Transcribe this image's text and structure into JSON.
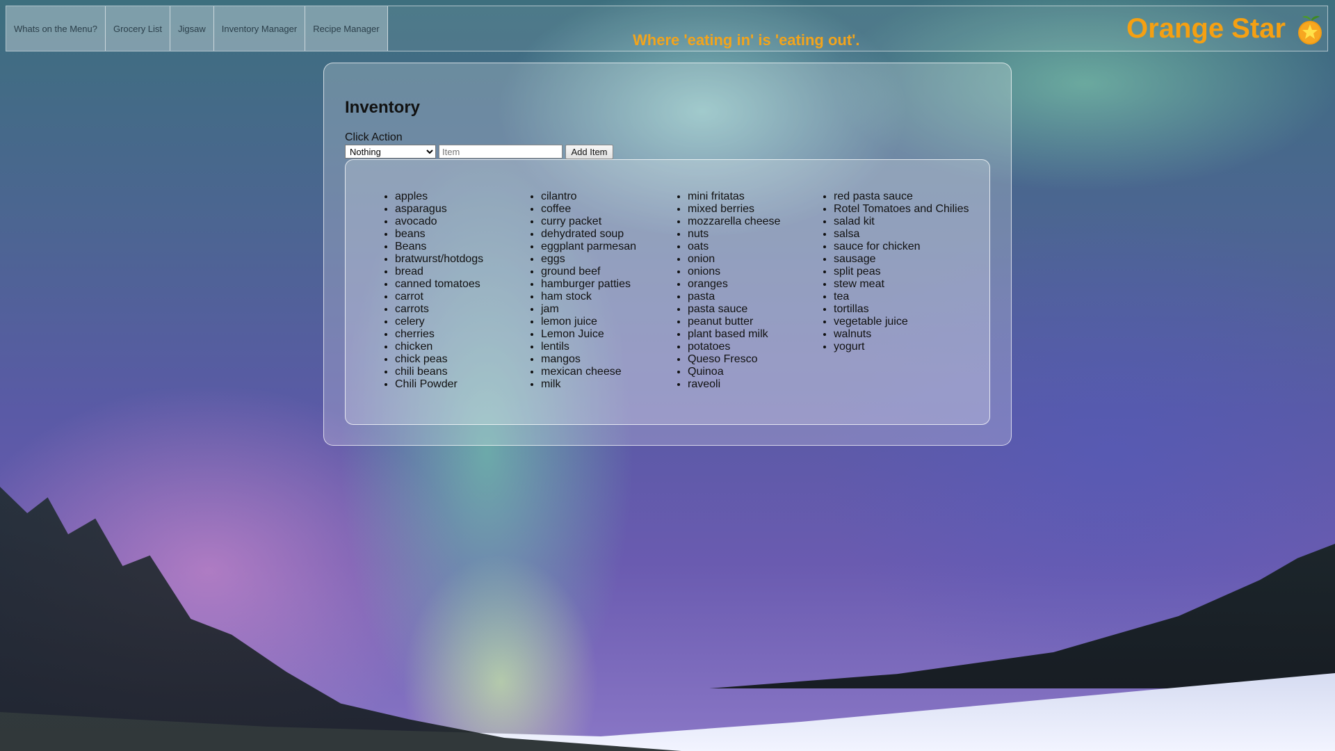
{
  "nav": {
    "items": [
      "Whats on the Menu?",
      "Grocery List",
      "Jigsaw",
      "Inventory Manager",
      "Recipe Manager"
    ]
  },
  "header": {
    "tagline": "Where 'eating in' is 'eating out'.",
    "brand": "Orange Star",
    "logo_icon": "orange-star-icon"
  },
  "colors": {
    "brand": "#f5a012",
    "tagline": "#f2a41c"
  },
  "main": {
    "title": "Inventory",
    "action_label": "Click Action",
    "action_select": {
      "selected": "Nothing"
    },
    "item_input": {
      "value": "",
      "placeholder": "Item"
    },
    "add_button": "Add Item",
    "columns": [
      [
        "apples",
        "asparagus",
        "avocado",
        "beans",
        "Beans",
        "bratwurst/hotdogs",
        "bread",
        "canned tomatoes",
        "carrot",
        "carrots",
        "celery",
        "cherries",
        "chicken",
        "chick peas",
        "chili beans",
        "Chili Powder"
      ],
      [
        "cilantro",
        "coffee",
        "curry packet",
        "dehydrated soup",
        "eggplant parmesan",
        "eggs",
        "ground beef",
        "hamburger patties",
        "ham stock",
        "jam",
        "lemon juice",
        "Lemon Juice",
        "lentils",
        "mangos",
        "mexican cheese",
        "milk"
      ],
      [
        "mini fritatas",
        "mixed berries",
        "mozzarella cheese",
        "nuts",
        "oats",
        "onion",
        "onions",
        "oranges",
        "pasta",
        "pasta sauce",
        "peanut butter",
        "plant based milk",
        "potatoes",
        "Queso Fresco",
        "Quinoa",
        "raveoli"
      ],
      [
        "red pasta sauce",
        "Rotel Tomatoes and Chilies",
        "salad kit",
        "salsa",
        "sauce for chicken",
        "sausage",
        "split peas",
        "stew meat",
        "tea",
        "tortillas",
        "vegetable juice",
        "walnuts",
        "yogurt"
      ]
    ]
  }
}
